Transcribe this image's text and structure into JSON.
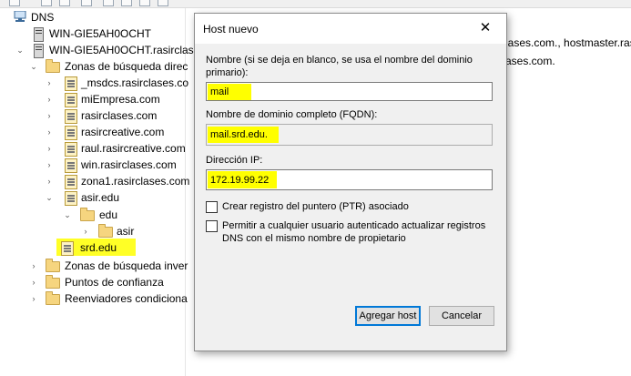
{
  "tree": {
    "root_label": "DNS",
    "server_short": "WIN-GIE5AH0OCHT",
    "server_full": "WIN-GIE5AH0OCHT.rasirclas",
    "forward_zones": "Zonas de búsqueda direc",
    "zones": [
      "_msdcs.rasirclases.co",
      "miEmpresa.com",
      "rasirclases.com",
      "rasircreative.com",
      "raul.rasircreative.com",
      "win.rasirclases.com",
      "zona1.rasirclases.com"
    ],
    "asir_edu": "asir.edu",
    "edu": "edu",
    "asir": "asir",
    "srd_edu": "srd.edu",
    "reverse_zones": "Zonas de búsqueda inver",
    "trust_points": "Puntos de confianza",
    "conditional_forwarders": "Reenviadores condiciona"
  },
  "right_panel": {
    "line1": "lases.com., hostmaster.ras",
    "line2": "ases.com."
  },
  "dialog": {
    "title": "Host nuevo",
    "close_glyph": "✕",
    "name_label_line1": "Nombre (si se deja en blanco, se usa el nombre del dominio",
    "name_label_line2": "primario):",
    "name_value": "mail",
    "fqdn_label": "Nombre de dominio completo (FQDN):",
    "fqdn_value": "mail.srd.edu.",
    "ip_label": "Dirección IP:",
    "ip_value": "172.19.99.22",
    "ptr_checkbox_label": "Crear registro del puntero (PTR) asociado",
    "ptr_checked": false,
    "auth_checkbox_line1": "Permitir a cualquier usuario autenticado actualizar registros",
    "auth_checkbox_line2": "DNS con el mismo nombre de propietario",
    "auth_checked": false,
    "add_button": "Agregar host",
    "cancel_button": "Cancelar"
  },
  "colors": {
    "highlight": "#ffff00",
    "focus_border": "#0078d7",
    "folder": "#f6d57f"
  }
}
